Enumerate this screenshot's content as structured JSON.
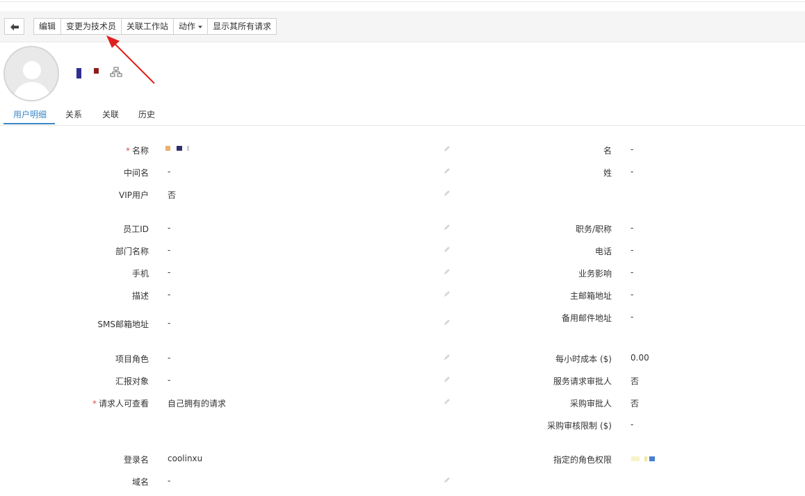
{
  "toolbar": {
    "back_icon": "arrow-left-icon",
    "edit": "编辑",
    "change_to_tech": "变更为技术员",
    "link_workstation": "关联工作站",
    "actions": "动作",
    "show_requests": "显示其所有请求"
  },
  "tabs": [
    "用户明细",
    "关系",
    "关联",
    "历史"
  ],
  "fields_left": [
    {
      "label": "名称",
      "value": "",
      "required": true
    },
    {
      "label": "中间名",
      "value": "-"
    },
    {
      "label": "VIP用户",
      "value": "否"
    },
    {
      "label": "员工ID",
      "value": "-"
    },
    {
      "label": "部门名称",
      "value": "-"
    },
    {
      "label": "手机",
      "value": "-"
    },
    {
      "label": "描述",
      "value": "-"
    },
    {
      "label": "SMS邮箱地址",
      "value": "-"
    },
    {
      "label": "项目角色",
      "value": "-"
    },
    {
      "label": "汇报对象",
      "value": "-"
    },
    {
      "label": "请求人可查看",
      "value": "自己拥有的请求",
      "required": true
    },
    {
      "label": "登录名",
      "value": "coolinxu"
    },
    {
      "label": "域名",
      "value": "-"
    }
  ],
  "fields_right": [
    {
      "label": "名",
      "value": "-"
    },
    {
      "label": "姓",
      "value": "-"
    },
    {
      "label": "职务/职称",
      "value": "-"
    },
    {
      "label": "电话",
      "value": "-"
    },
    {
      "label": "业务影响",
      "value": "-"
    },
    {
      "label": "主邮箱地址",
      "value": "-"
    },
    {
      "label": "备用邮件地址",
      "value": "-"
    },
    {
      "label": "每小时成本 ($)",
      "value": "0.00"
    },
    {
      "label": "服务请求审批人",
      "value": "否"
    },
    {
      "label": "采购审批人",
      "value": "否"
    },
    {
      "label": "采购审核限制 ($)",
      "value": "-"
    },
    {
      "label": "指定的角色权限",
      "value": ""
    }
  ],
  "colors": {
    "accent": "#3a87c8",
    "required": "#d9534f",
    "annotation_arrow": "#e02020"
  }
}
